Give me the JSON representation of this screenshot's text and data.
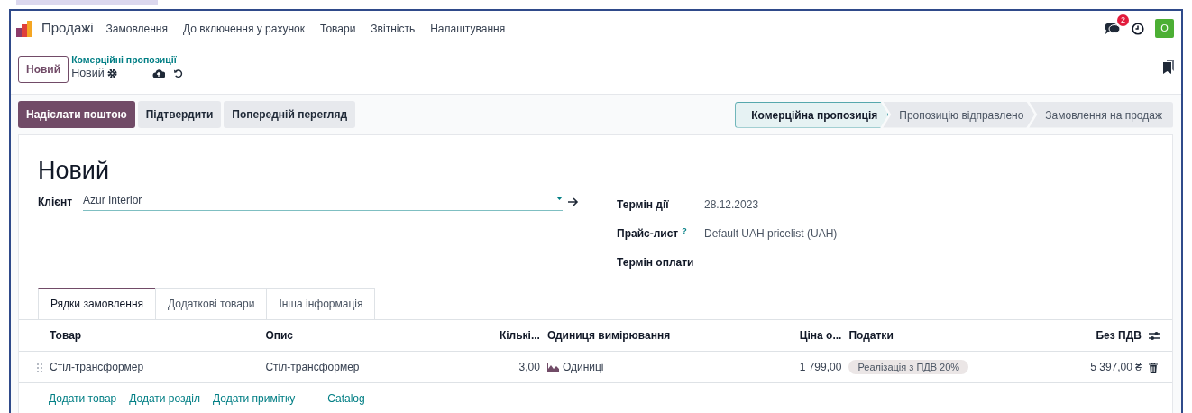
{
  "app": {
    "name": "Продажі"
  },
  "menu": [
    {
      "label": "Замовлення"
    },
    {
      "label": "До включення у рахунок"
    },
    {
      "label": "Товари"
    },
    {
      "label": "Звітність"
    },
    {
      "label": "Налаштування"
    }
  ],
  "systray": {
    "messages_badge": "2",
    "avatar": "O"
  },
  "new_button": "Новий",
  "breadcrumb": {
    "parent": "Комерційні пропозиції",
    "current": "Новий"
  },
  "actions": [
    {
      "label": "Надіслати поштою",
      "kind": "primary"
    },
    {
      "label": "Підтвердити",
      "kind": "secondary"
    },
    {
      "label": "Попередній перегляд",
      "kind": "secondary"
    }
  ],
  "statusbar": [
    {
      "label": "Комерційна пропозиція",
      "selected": true
    },
    {
      "label": "Пропозицію відправлено",
      "selected": false
    },
    {
      "label": "Замовлення на продаж",
      "selected": false
    }
  ],
  "form": {
    "title": "Новий",
    "client": {
      "label": "Клієнт",
      "value": "Azur Interior"
    },
    "fields": [
      {
        "label": "Термін дії",
        "value": "28.12.2023"
      },
      {
        "label": "Прайс-лист",
        "help": "?",
        "value": "Default UAH pricelist (UAH)"
      },
      {
        "label": "Термін оплати"
      }
    ]
  },
  "tabs": [
    {
      "label": "Рядки замовлення",
      "selected": true
    },
    {
      "label": "Додаткові товари",
      "selected": false
    },
    {
      "label": "Інша інформація",
      "selected": false
    }
  ],
  "table": {
    "columns": [
      {
        "label": "Товар",
        "kind": "text"
      },
      {
        "label": "Опис",
        "kind": "text"
      },
      {
        "label": "Кількі...",
        "kind": "number"
      },
      {
        "label": "Одиниця вимірювання",
        "kind": "text"
      },
      {
        "label": "Ціна о...",
        "kind": "number"
      },
      {
        "label": "Податки",
        "kind": "text"
      },
      {
        "label": "Без ПДВ",
        "kind": "number"
      }
    ],
    "rows": [
      {
        "cells": [
          "Стіл-трансформер",
          "Стіл-трансформер",
          "3,00",
          "Одиниці",
          "1 799,00",
          "Реалізація з ПДВ 20%",
          "5 397,00 ₴"
        ]
      }
    ]
  },
  "add_links": [
    {
      "label": "Додати товар"
    },
    {
      "label": "Додати розділ"
    },
    {
      "label": "Додати примітку"
    },
    {
      "label": "Catalog"
    }
  ]
}
